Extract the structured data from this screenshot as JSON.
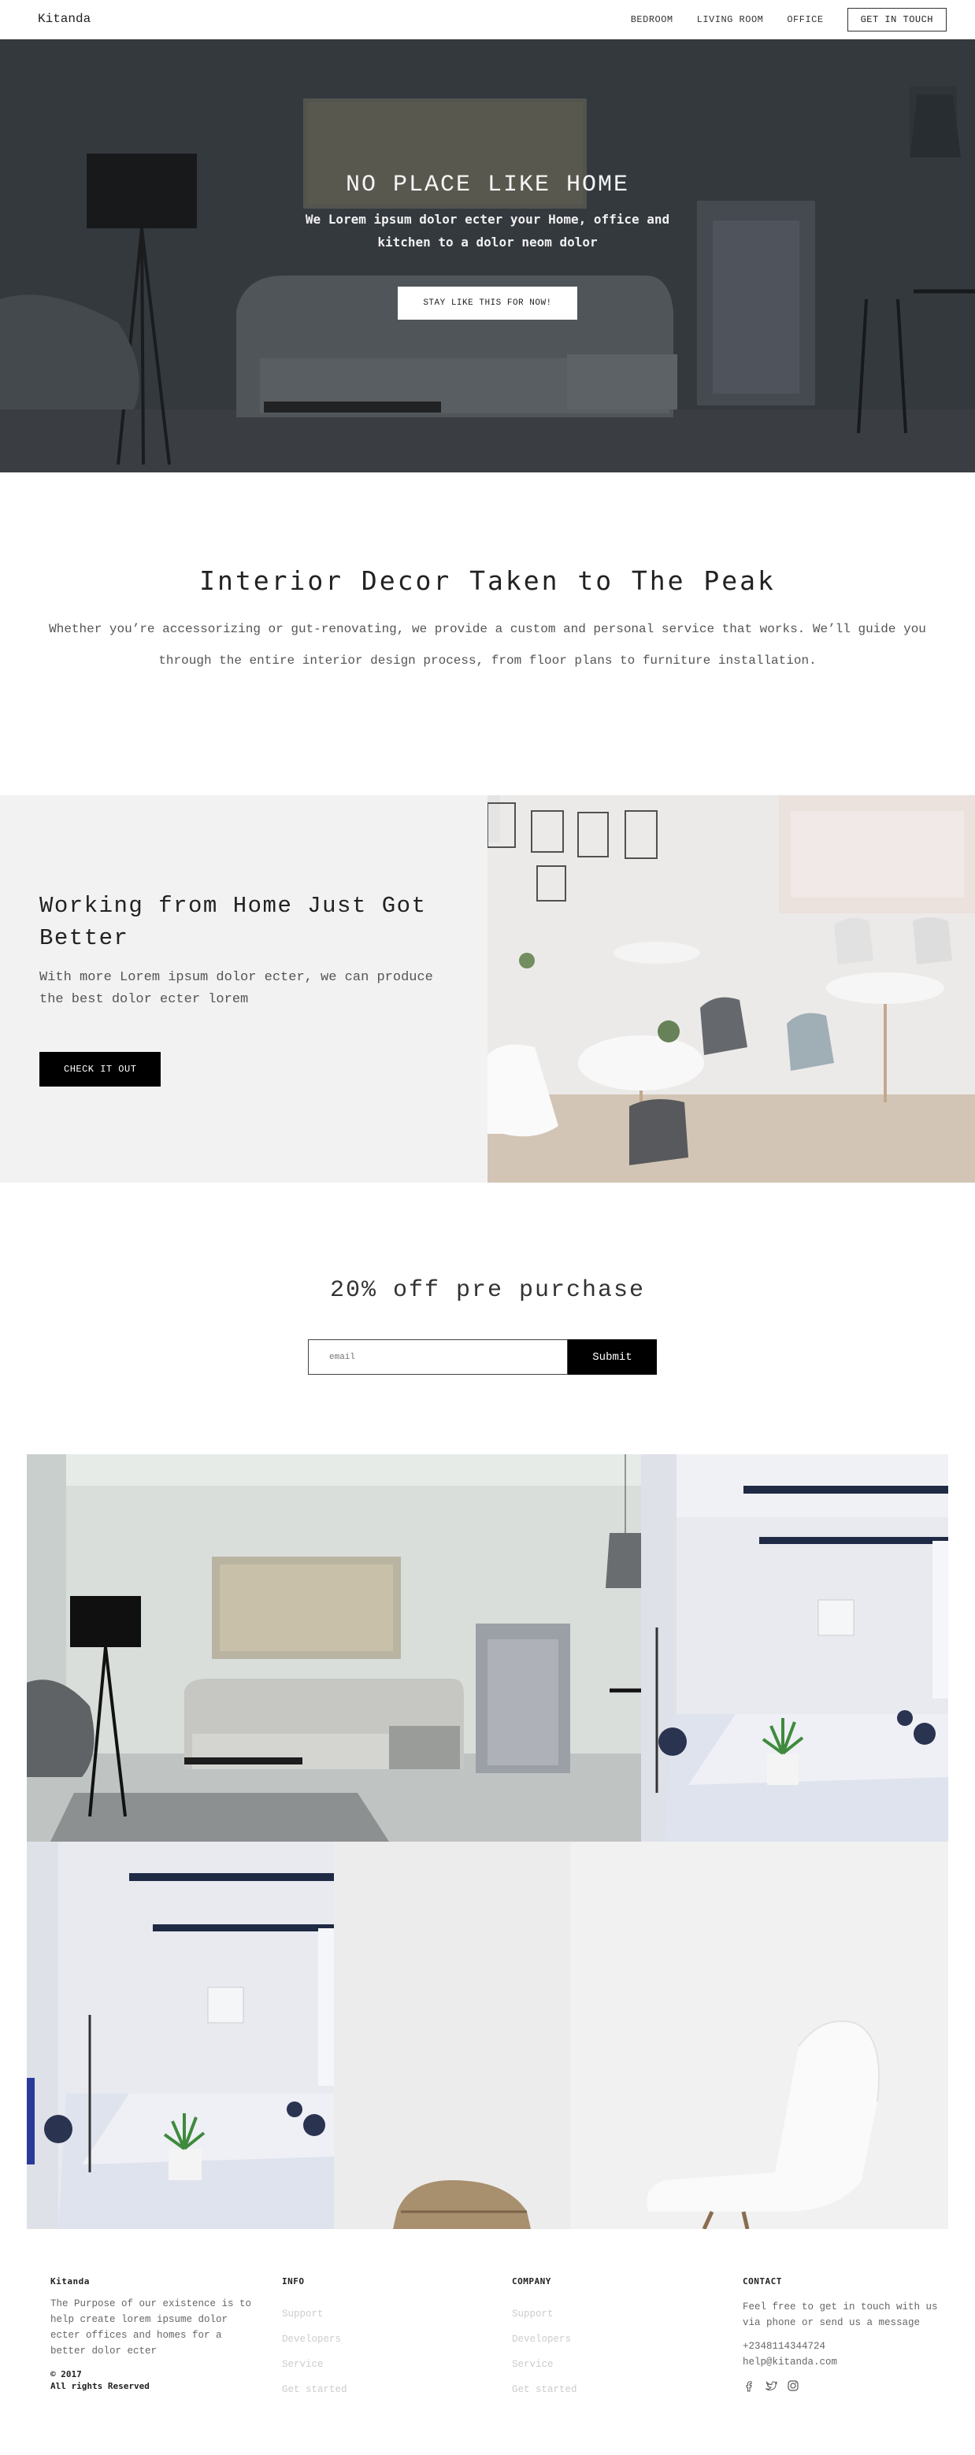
{
  "nav": {
    "brand": "Kitanda",
    "links": [
      "BEDROOM",
      "LIVING ROOM",
      "OFFICE"
    ],
    "cta": "GET IN TOUCH"
  },
  "hero": {
    "title": "NO PLACE LIKE HOME",
    "subtitle": "We Lorem ipsum dolor ecter your Home, office and kitchen to a dolor neom dolor",
    "button": "STAY LIKE THIS FOR NOW!"
  },
  "intro": {
    "title": "Interior Decor Taken to The Peak",
    "text": "Whether you’re accessorizing or gut-renovating, we provide a custom and personal service that works. We’ll guide you through the entire interior design process, from floor plans to furniture installation."
  },
  "work": {
    "title": "Working from Home Just Got Better",
    "text": "With more Lorem ipsum dolor ecter, we can produce the best dolor ecter lorem",
    "button": "CHECK IT OUT"
  },
  "discount": {
    "title": "20% off pre purchase",
    "email_placeholder": "email",
    "submit": "Submit"
  },
  "footer": {
    "brand": "Kitanda",
    "about": "The Purpose of our existence is to help create lorem ipsume dolor ecter offices and homes for a better dolor ecter",
    "copyright_1": "© 2017",
    "copyright_2": "All rights Reserved",
    "info": {
      "heading": "INFO",
      "links": [
        "Support",
        "Developers",
        "Service",
        "Get started"
      ]
    },
    "company": {
      "heading": "COMPANY",
      "links": [
        "Support",
        "Developers",
        "Service",
        "Get started"
      ]
    },
    "contact": {
      "heading": "CONTACT",
      "text": "Feel free to get in touch with us via phone or send us a message",
      "phone": "+2348114344724",
      "email": "help@kitanda.com",
      "socials": [
        "facebook-icon",
        "twitter-icon",
        "instagram-icon"
      ]
    }
  },
  "colors": {
    "accent": "#000000",
    "panel": "#f2f2f2",
    "hero_overlay": "#2e3338"
  }
}
